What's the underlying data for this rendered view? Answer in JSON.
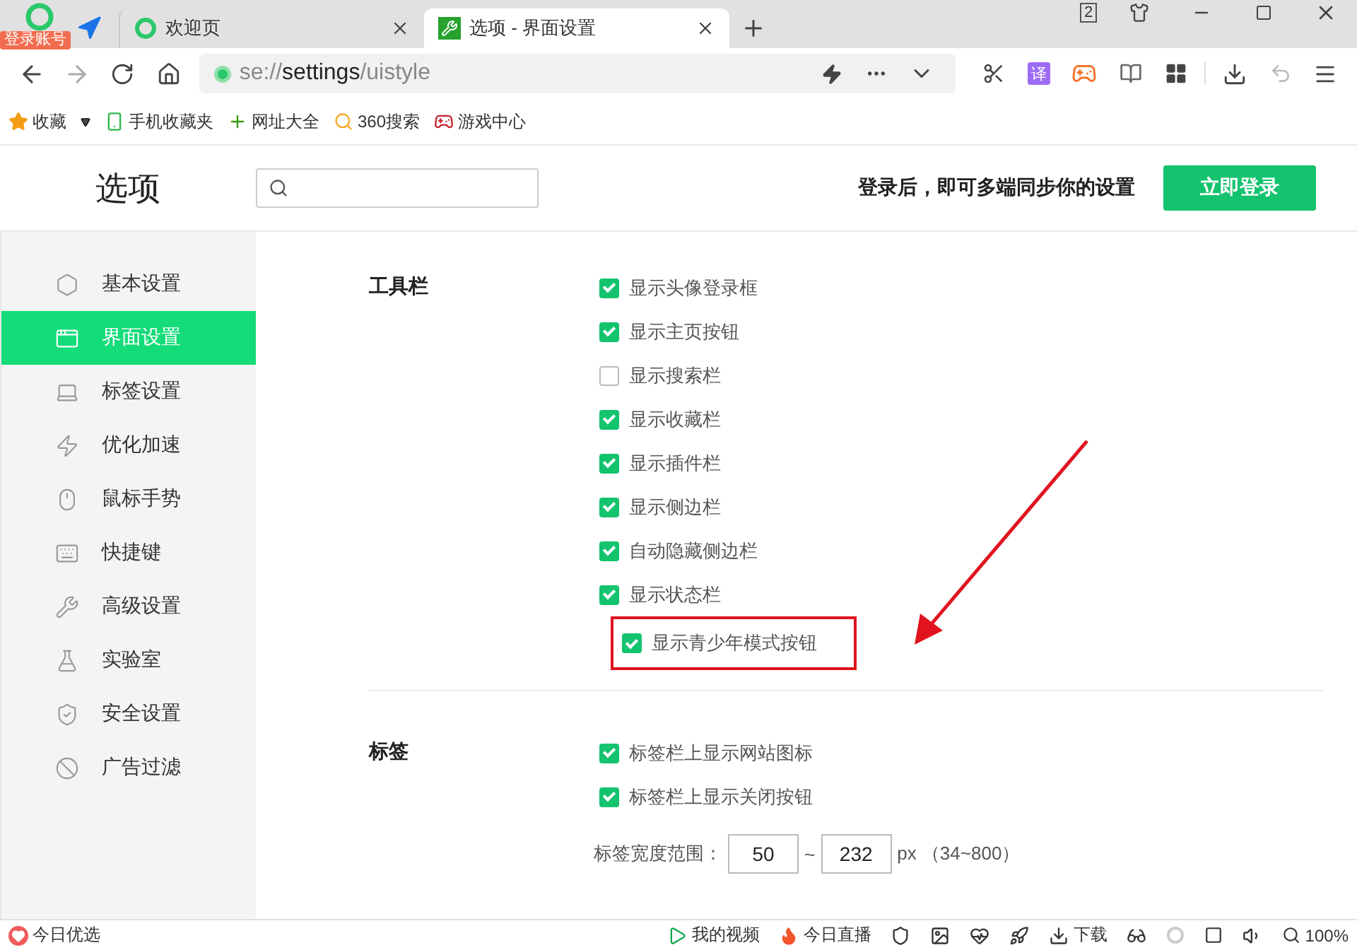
{
  "browser": {
    "login_badge": "登录账号",
    "tabs": [
      {
        "title": "欢迎页",
        "selected": false
      },
      {
        "title": "选项 - 界面设置",
        "selected": true
      }
    ],
    "tab_count": "2",
    "address": {
      "scheme": "se://",
      "host": "settings",
      "path": "/uistyle"
    },
    "translate_label": "译"
  },
  "bookmarks": [
    {
      "label": "收藏"
    },
    {
      "label": "手机收藏夹"
    },
    {
      "label": "网址大全"
    },
    {
      "label": "360搜索"
    },
    {
      "label": "游戏中心"
    }
  ],
  "page": {
    "title": "选项",
    "sync_text": "登录后，即可多端同步你的设置",
    "login_button": "立即登录"
  },
  "sidebar": [
    {
      "label": "基本设置",
      "selected": false
    },
    {
      "label": "界面设置",
      "selected": true
    },
    {
      "label": "标签设置",
      "selected": false
    },
    {
      "label": "优化加速",
      "selected": false
    },
    {
      "label": "鼠标手势",
      "selected": false
    },
    {
      "label": "快捷键",
      "selected": false
    },
    {
      "label": "高级设置",
      "selected": false
    },
    {
      "label": "实验室",
      "selected": false
    },
    {
      "label": "安全设置",
      "selected": false
    },
    {
      "label": "广告过滤",
      "selected": false
    }
  ],
  "sections": [
    {
      "title": "工具栏",
      "options": [
        {
          "label": "显示头像登录框",
          "checked": true
        },
        {
          "label": "显示主页按钮",
          "checked": true
        },
        {
          "label": "显示搜索栏",
          "checked": false
        },
        {
          "label": "显示收藏栏",
          "checked": true
        },
        {
          "label": "显示插件栏",
          "checked": true
        },
        {
          "label": "显示侧边栏",
          "checked": true
        },
        {
          "label": "自动隐藏侧边栏",
          "checked": true
        },
        {
          "label": "显示状态栏",
          "checked": true,
          "children": [
            {
              "label": "显示青少年模式按钮",
              "checked": true,
              "highlighted": true
            }
          ]
        }
      ]
    },
    {
      "title": "标签",
      "options": [
        {
          "label": "标签栏上显示网站图标",
          "checked": true
        },
        {
          "label": "标签栏上显示关闭按钮",
          "checked": true
        }
      ],
      "width_range": {
        "label": "标签宽度范围：",
        "min": "50",
        "separator": "~",
        "max": "232",
        "unit": "px （34~800）"
      }
    }
  ],
  "status_bar": {
    "left": "今日优选",
    "items": [
      {
        "label": "我的视频"
      },
      {
        "label": "今日直播"
      },
      {
        "label": "下载"
      }
    ],
    "zoom": "100%"
  }
}
